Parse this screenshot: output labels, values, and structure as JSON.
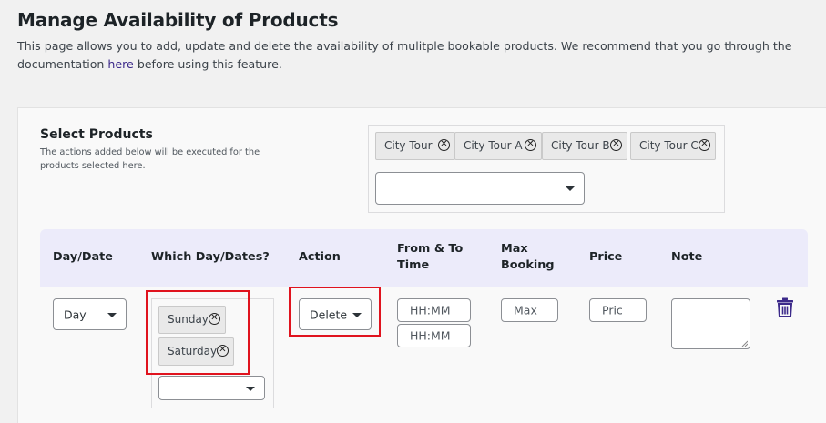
{
  "page": {
    "title": "Manage Availability of Products",
    "description": "This page allows you to add, update and delete the availability of mulitple bookable products. We recommend that you go through the documentation",
    "description_link": "here",
    "description_suffix": "before using this feature."
  },
  "select_products": {
    "title": "Select Products",
    "subtitle": "The actions added below will be executed for the products selected here.",
    "chips": [
      "City Tour",
      "City Tour A",
      "City Tour B",
      "City Tour C"
    ],
    "dropdown_value": ""
  },
  "table": {
    "headers": {
      "day_date": "Day/Date",
      "which_days": "Which Day/Dates?",
      "action": "Action",
      "from_to_time": "From & To Time",
      "max_booking": "Max Booking",
      "price": "Price",
      "note": "Note"
    },
    "row": {
      "day_type": "Day",
      "days": [
        "Sunday",
        "Saturday"
      ],
      "days_dropdown_value": "",
      "action": "Delete",
      "from_time_placeholder": "HH:MM",
      "to_time_placeholder": "HH:MM",
      "max_booking_placeholder": "Max",
      "price_placeholder": "Pric",
      "note_value": ""
    }
  },
  "icons": {
    "remove": "close-circle-icon",
    "dropdown": "caret-down-icon",
    "delete_row": "trash-icon"
  },
  "colors": {
    "header_bg": "#ecebfa",
    "highlight_red": "#e0131e",
    "trash_purple": "#3c2a8a",
    "link": "#3c2a8a"
  }
}
